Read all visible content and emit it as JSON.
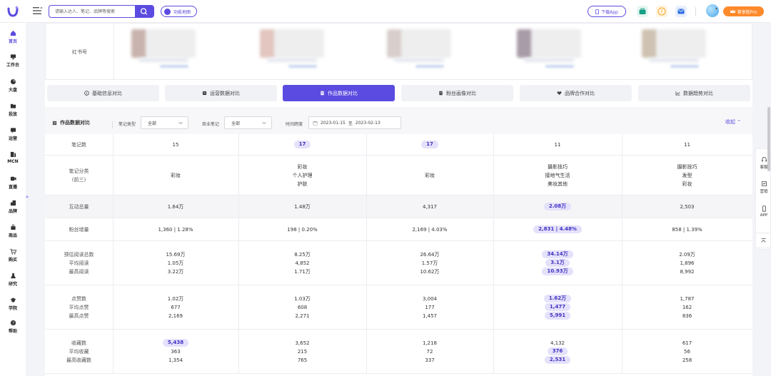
{
  "header": {
    "search_placeholder": "请输入达人、笔记、品牌等搜索",
    "feature_map": "功能地图",
    "download_app": "下载App",
    "pro_badge": "尊享版Pro"
  },
  "sidebar": {
    "items": [
      {
        "label": "首页",
        "icon": "home-icon",
        "active": true
      },
      {
        "label": "工作台",
        "icon": "monitor-icon"
      },
      {
        "label": "大盘",
        "icon": "pie-chart-icon"
      },
      {
        "label": "投放",
        "icon": "folder-icon"
      },
      {
        "label": "运营",
        "icon": "chat-icon"
      },
      {
        "label": "MCN",
        "icon": "mcn-icon"
      },
      {
        "label": "直播",
        "icon": "video-icon"
      },
      {
        "label": "品牌",
        "icon": "brand-icon"
      },
      {
        "label": "商品",
        "icon": "bag-icon"
      },
      {
        "label": "购买",
        "icon": "cart-icon"
      },
      {
        "label": "研究",
        "icon": "flask-icon"
      },
      {
        "label": "学院",
        "icon": "graduation-icon"
      },
      {
        "label": "帮助",
        "icon": "help-icon"
      }
    ]
  },
  "redbook_row": {
    "label": "红书号"
  },
  "tabs": [
    {
      "label": "基础信息对比",
      "icon": "info-icon"
    },
    {
      "label": "运营数据对比",
      "icon": "ops-icon"
    },
    {
      "label": "作品数据对比",
      "icon": "doc-icon",
      "active": true
    },
    {
      "label": "粉丝画像对比",
      "icon": "fans-icon"
    },
    {
      "label": "品牌合作对比",
      "icon": "heart-icon"
    },
    {
      "label": "数据趋势对比",
      "icon": "trend-icon"
    }
  ],
  "filters": {
    "title": "作品数据对比",
    "note_type_label": "笔记类型",
    "note_type_value": "全部",
    "commercial_label": "商业笔记",
    "commercial_value": "全部",
    "time_label": "时间跨度",
    "date_start": "2023-01-15",
    "date_sep": "至",
    "date_end": "2023-02-13",
    "collapse": "收起"
  },
  "table": {
    "rows": [
      {
        "label": [
          "笔记数"
        ],
        "cells": [
          [
            "15"
          ],
          [
            "17"
          ],
          [
            "17"
          ],
          [
            "11"
          ],
          [
            "11"
          ]
        ],
        "hl": [
          [
            false
          ],
          [
            true
          ],
          [
            true
          ],
          [
            false
          ],
          [
            false
          ]
        ]
      },
      {
        "label": [
          "笔记分类",
          "(前三)"
        ],
        "cells": [
          [
            "彩妆"
          ],
          [
            "彩妆",
            "个人护理",
            "护肤"
          ],
          [
            "彩妆"
          ],
          [
            "摄影技巧",
            "接地气生活",
            "美妆其他"
          ],
          [
            "摄影技巧",
            "发型",
            "彩妆"
          ]
        ]
      },
      {
        "label": [
          "互动总量"
        ],
        "shade": true,
        "cells": [
          [
            "1.64万"
          ],
          [
            "1.48万"
          ],
          [
            "4,317"
          ],
          [
            "2.08万"
          ],
          [
            "2,503"
          ]
        ],
        "hl": [
          [
            false
          ],
          [
            false
          ],
          [
            false
          ],
          [
            true
          ],
          [
            false
          ]
        ]
      },
      {
        "label": [
          "粉丝增量"
        ],
        "cells": [
          [
            "1,360 | 1.28%"
          ],
          [
            "198 | 0.20%"
          ],
          [
            "2,169 | 4.03%"
          ],
          [
            "2,831 | 4.48%"
          ],
          [
            "858 | 1.39%"
          ]
        ],
        "hl": [
          [
            false
          ],
          [
            false
          ],
          [
            false
          ],
          [
            true
          ],
          [
            false
          ]
        ]
      },
      {
        "label": [
          "预估阅读总数",
          "平均阅读",
          "最高阅读"
        ],
        "cells": [
          [
            "15.69万",
            "1.05万",
            "3.22万"
          ],
          [
            "8.25万",
            "4,852",
            "1.71万"
          ],
          [
            "26.64万",
            "1.57万",
            "10.62万"
          ],
          [
            "34.14万",
            "3.1万",
            "10.93万"
          ],
          [
            "2.09万",
            "1,896",
            "8,992"
          ]
        ],
        "hl": [
          [
            false,
            false,
            false
          ],
          [
            false,
            false,
            false
          ],
          [
            false,
            false,
            false
          ],
          [
            true,
            true,
            true
          ],
          [
            false,
            false,
            false
          ]
        ]
      },
      {
        "label": [
          "点赞数",
          "平均点赞",
          "最高点赞"
        ],
        "cells": [
          [
            "1.02万",
            "677",
            "2,169"
          ],
          [
            "1.03万",
            "608",
            "2,271"
          ],
          [
            "3,004",
            "177",
            "1,457"
          ],
          [
            "1.62万",
            "1,477",
            "5,991"
          ],
          [
            "1,787",
            "162",
            "836"
          ]
        ],
        "hl": [
          [
            false,
            false,
            false
          ],
          [
            false,
            false,
            false
          ],
          [
            false,
            false,
            false
          ],
          [
            true,
            true,
            true
          ],
          [
            false,
            false,
            false
          ]
        ]
      },
      {
        "label": [
          "收藏数",
          "平均收藏",
          "最高收藏数"
        ],
        "cells": [
          [
            "5,438",
            "363",
            "1,354"
          ],
          [
            "3,652",
            "215",
            "765"
          ],
          [
            "1,218",
            "72",
            "337"
          ],
          [
            "4,132",
            "376",
            "2,531"
          ],
          [
            "617",
            "56",
            "258"
          ]
        ],
        "hl": [
          [
            true,
            false,
            false
          ],
          [
            false,
            false,
            false
          ],
          [
            false,
            false,
            false
          ],
          [
            false,
            true,
            true
          ],
          [
            false,
            false,
            false
          ]
        ]
      }
    ]
  },
  "right_float": {
    "items": [
      {
        "label": "客服",
        "icon": "headset-icon"
      },
      {
        "label": "营销",
        "icon": "marketing-icon"
      },
      {
        "label": "APP",
        "icon": "phone-icon"
      }
    ]
  },
  "colors": {
    "accent": "#5b4be0",
    "pro": "#ff8a2b",
    "highlight_bg": "#e4e1fb"
  }
}
